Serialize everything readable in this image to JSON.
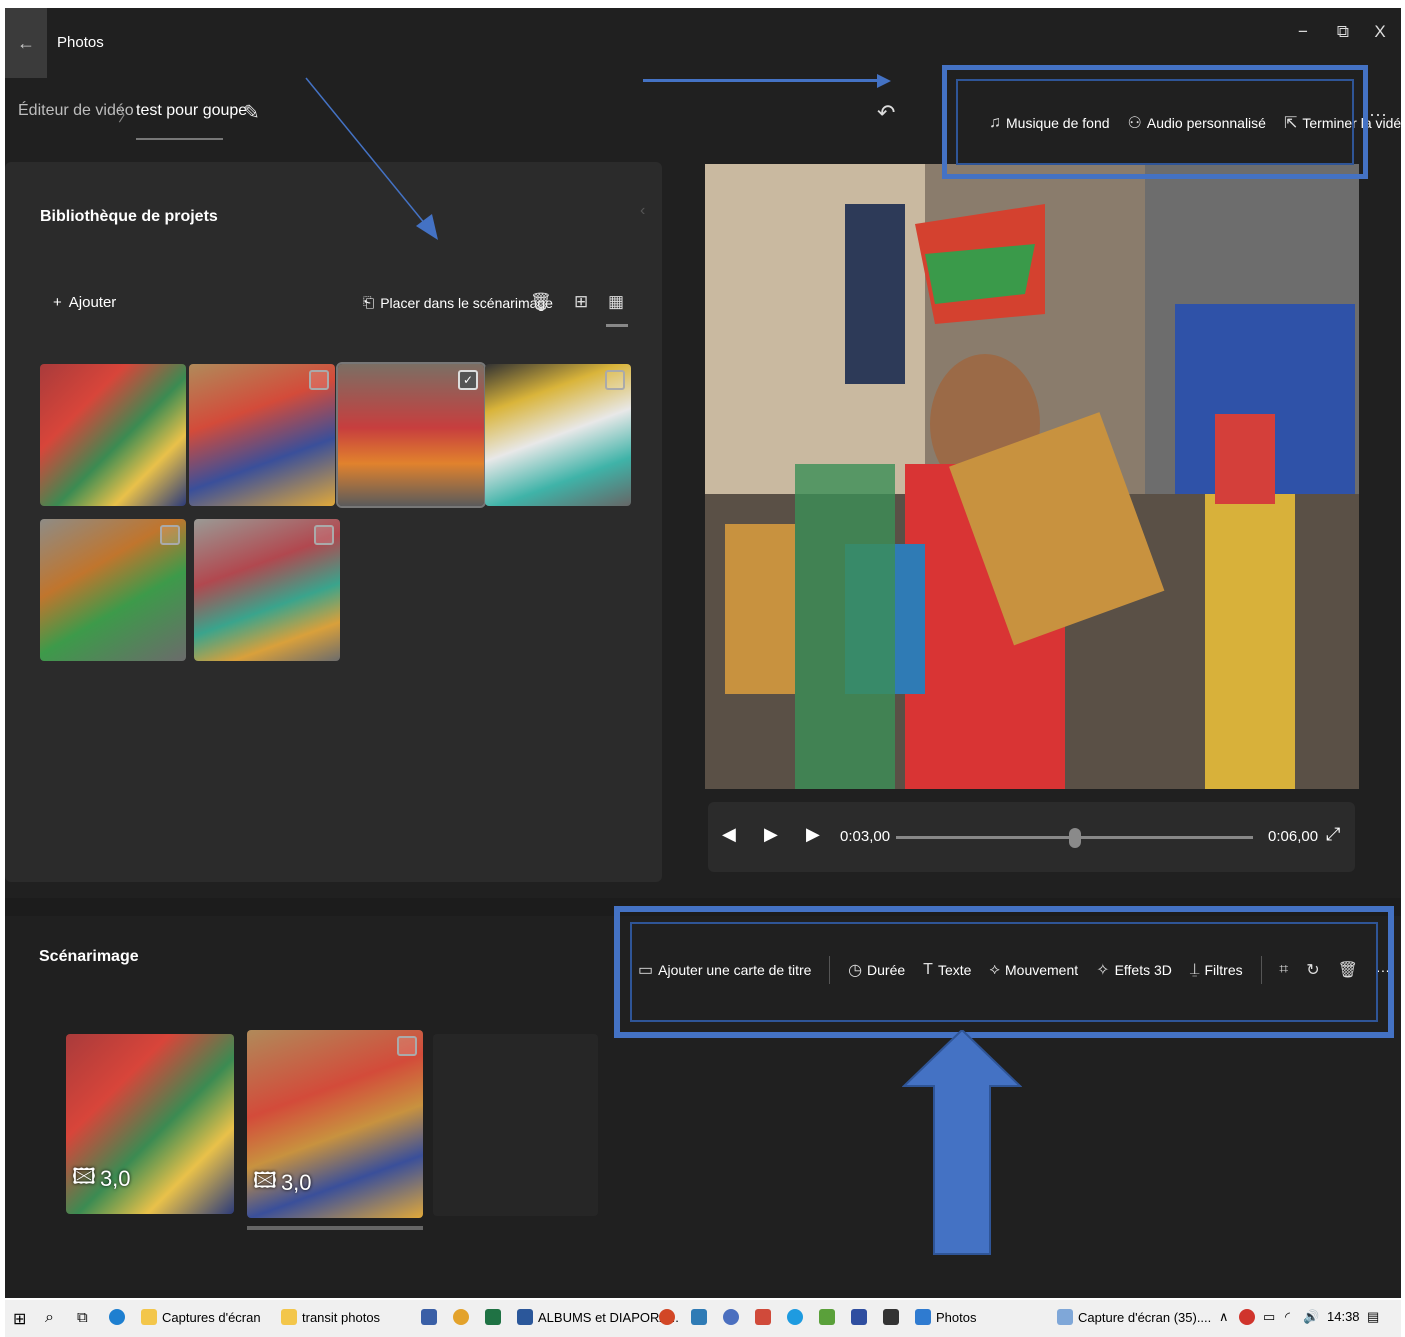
{
  "window": {
    "title": "Photos",
    "minimize": "−",
    "restore": "⧉",
    "close": "X",
    "back": "←"
  },
  "breadcrumb": {
    "root": "Éditeur de vidéo",
    "separator": "〉",
    "project": "test pour goupe"
  },
  "toolbar": {
    "music_label": "Musique de fond",
    "custom_audio_label": "Audio personnalisé",
    "finish_label": "Terminer la vidéo",
    "more": "···"
  },
  "library": {
    "title": "Bibliothèque de projets",
    "add_label": "Ajouter",
    "place_label": "Placer dans le scénarimage"
  },
  "player": {
    "current_time": "0:03,00",
    "total_time": "0:06,00",
    "progress": 0.5
  },
  "storyboard": {
    "title": "Scénarimage",
    "tools": {
      "title_card": "Ajouter une carte de titre",
      "duration": "Durée",
      "text": "Texte",
      "motion": "Mouvement",
      "effects3d": "Effets 3D",
      "filters": "Filtres",
      "more": "···"
    },
    "clips": [
      {
        "duration": "3,0"
      },
      {
        "duration": "3,0"
      }
    ]
  },
  "taskbar": {
    "items": [
      "Captures d'écran",
      "transit photos",
      "ALBUMS et DIAPORA...",
      "Photos",
      "Capture d'écran (35)...."
    ],
    "clock": "14:38"
  },
  "colors": {
    "accent_annotation": "#4472c4",
    "app_bg": "#202020",
    "panel_bg": "#2b2b2b"
  }
}
